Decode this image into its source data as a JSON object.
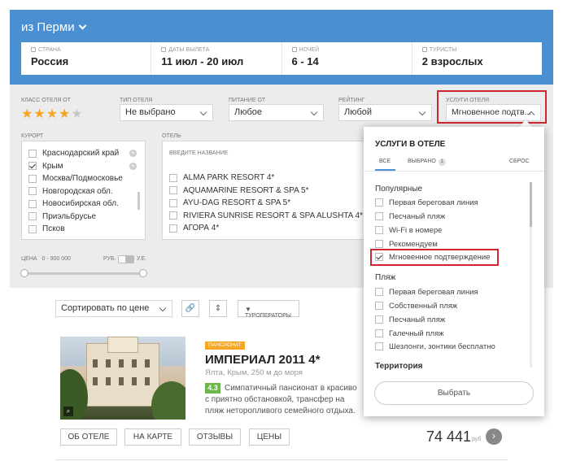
{
  "header": {
    "from_label": "из Перми",
    "fields": [
      {
        "label": "СТРАНА",
        "value": "Россия",
        "icon": "pin-icon"
      },
      {
        "label": "ДАТЫ ВЫЛЕТА",
        "value": "11 июл - 20 июл",
        "icon": "calendar-icon"
      },
      {
        "label": "НОЧЕЙ",
        "value": "6 - 14",
        "icon": "moon-icon"
      },
      {
        "label": "ТУРИСТЫ",
        "value": "2 взрослых",
        "icon": "person-icon"
      }
    ]
  },
  "filters": {
    "hotel_class_label": "КЛАСС ОТЕЛЯ ОТ",
    "stars": {
      "filled": 4,
      "total": 5
    },
    "hotel_type": {
      "label": "ТИП ОТЕЛЯ",
      "value": "Не выбрано"
    },
    "meal": {
      "label": "ПИТАНИЕ ОТ",
      "value": "Любое"
    },
    "rating": {
      "label": "РЕЙТИНГ",
      "value": "Любой"
    },
    "services": {
      "label": "УСЛУГИ ОТЕЛЯ",
      "value": "Мгновенное подтв..."
    },
    "resort": {
      "label": "КУРОРТ",
      "items": [
        {
          "label": "Краснодарский край",
          "checked": false,
          "plus": true
        },
        {
          "label": "Крым",
          "checked": true,
          "plus": true
        },
        {
          "label": "Москва/Подмосковье",
          "checked": false,
          "plus": false
        },
        {
          "label": "Новгородская обл.",
          "checked": false,
          "plus": false
        },
        {
          "label": "Новосибирская обл.",
          "checked": false,
          "plus": false
        },
        {
          "label": "Приэльбрусье",
          "checked": false,
          "plus": false
        },
        {
          "label": "Псков",
          "checked": false,
          "plus": false
        }
      ]
    },
    "hotel": {
      "label": "ОТЕЛЬ",
      "placeholder": "ВВЕДИТЕ НАЗВАНИЕ",
      "items": [
        "ALMA PARK RESORT 4*",
        "AQUAMARINE RESORT & SPA 5*",
        "AYU-DAG RESORT & SPA 5*",
        "RIVIERA SUNRISE RESORT & SPA ALUSHTA 4*",
        "АГОРА 4*"
      ]
    },
    "price": {
      "label": "ЦЕНА",
      "range": "0 - 900 000",
      "currency_left": "РУБ.",
      "currency_right": "У.Е."
    }
  },
  "results_toolbar": {
    "sort": "Сортировать по цене",
    "operators": "ТУРОПЕРАТОРЫ"
  },
  "hotel_card": {
    "type_badge": "ПАНСИОНАТ",
    "name": "ИМПЕРИАЛ 2011 4*",
    "location": "Ялта, Крым, 250 м до моря",
    "rating": "4.3",
    "desc_line1": "Симпатичный пансионат в красиво",
    "desc_rest": "с приятно обстановкой, трансфер на пляж неторопливого семейного отдыха.",
    "buttons": [
      "ОБ ОТЕЛЕ",
      "НА КАРТЕ",
      "ОТЗЫВЫ",
      "ЦЕНЫ"
    ],
    "price": "74 441",
    "currency": "руб"
  },
  "popup": {
    "title": "УСЛУГИ В ОТЕЛЕ",
    "tabs": {
      "all": "ВСЕ",
      "selected": "ВЫБРАНО",
      "selected_count": "1",
      "reset": "СБРОС"
    },
    "sections": [
      {
        "title": "Популярные",
        "items": [
          {
            "label": "Первая береговая линия",
            "checked": false
          },
          {
            "label": "Песчаный пляж",
            "checked": false
          },
          {
            "label": "Wi-Fi в номере",
            "checked": false
          },
          {
            "label": "Рекомендуем",
            "checked": false
          },
          {
            "label": "Мгновенное подтверждение",
            "checked": true
          }
        ]
      },
      {
        "title": "Пляж",
        "items": [
          {
            "label": "Первая береговая линия",
            "checked": false
          },
          {
            "label": "Собственный пляж",
            "checked": false
          },
          {
            "label": "Песчаный пляж",
            "checked": false
          },
          {
            "label": "Галечный пляж",
            "checked": false
          },
          {
            "label": "Шезлонги, зонтики бесплатно",
            "checked": false
          }
        ]
      },
      {
        "title": "Территория",
        "items": []
      }
    ],
    "select_button": "Выбрать"
  },
  "colors": {
    "header_blue": "#4a8fd1",
    "star": "#f5a623",
    "highlight_red": "#d0262f",
    "rating_green": "#6cb64b"
  }
}
